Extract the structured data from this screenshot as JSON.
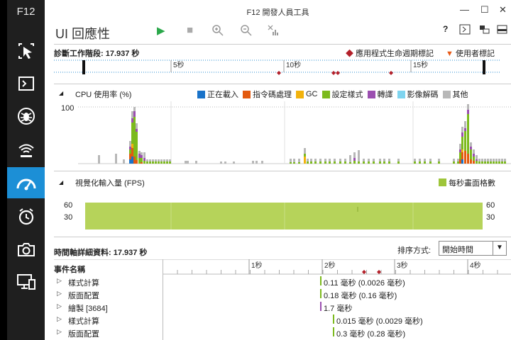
{
  "app": {
    "badge": "F12",
    "window_title": "F12 開發人員工具",
    "tool_name": "UI 回應性"
  },
  "window_controls": {
    "minimize": "—",
    "maximize": "☐",
    "close": "✕"
  },
  "toolbar": {
    "help": "?",
    "console_icon": ">_"
  },
  "sidebar": {
    "items": [
      "dom-explorer",
      "console",
      "debugger",
      "network",
      "ui-responsiveness",
      "profiler",
      "memory",
      "emulation"
    ]
  },
  "session": {
    "title": "診斷工作階段: 17.937 秒",
    "legend_app": "應用程式生命週期標記",
    "legend_user": "使用者標記",
    "ruler": [
      "5秒",
      "10秒",
      "15秒"
    ]
  },
  "cpu": {
    "title": "CPU 使用率 (%)",
    "y_label": "100",
    "legend": [
      {
        "label": "正在載入",
        "color": "#1a73c9"
      },
      {
        "label": "指令碼處理",
        "color": "#e35a0f"
      },
      {
        "label": "GC",
        "color": "#f2b20c"
      },
      {
        "label": "設定樣式",
        "color": "#7cba1d"
      },
      {
        "label": "轉譯",
        "color": "#9b4fb0"
      },
      {
        "label": "影像解碼",
        "color": "#7fd4ef"
      },
      {
        "label": "其他",
        "color": "#b8b8b8"
      }
    ]
  },
  "fps": {
    "title": "視覺化輸入量 (FPS)",
    "legend": "每秒畫面格數",
    "y60": "60",
    "y30": "30",
    "color": "#b6d35a"
  },
  "details": {
    "title": "時間軸詳細資料: 17.937 秒",
    "sort_label": "排序方式:",
    "sort_value": "開始時間",
    "col_header": "事件名稱",
    "ruler": [
      "1秒",
      "2秒",
      "3秒",
      "4秒"
    ],
    "events": [
      {
        "name": "樣式計算",
        "value": "0.11 毫秒 (0.0026 毫秒)",
        "color": "#7cba1d"
      },
      {
        "name": "版面配置",
        "value": "0.18 毫秒 (0.16 毫秒)",
        "color": "#7cba1d"
      },
      {
        "name": "繪製 [3684]",
        "value": "1.7 毫秒",
        "color": "#9b4fb0"
      },
      {
        "name": "樣式計算",
        "value": "0.015 毫秒 (0.0029 毫秒)",
        "color": "#7cba1d"
      },
      {
        "name": "版面配置",
        "value": "0.3 毫秒 (0.28 毫秒)",
        "color": "#7cba1d"
      }
    ]
  }
}
